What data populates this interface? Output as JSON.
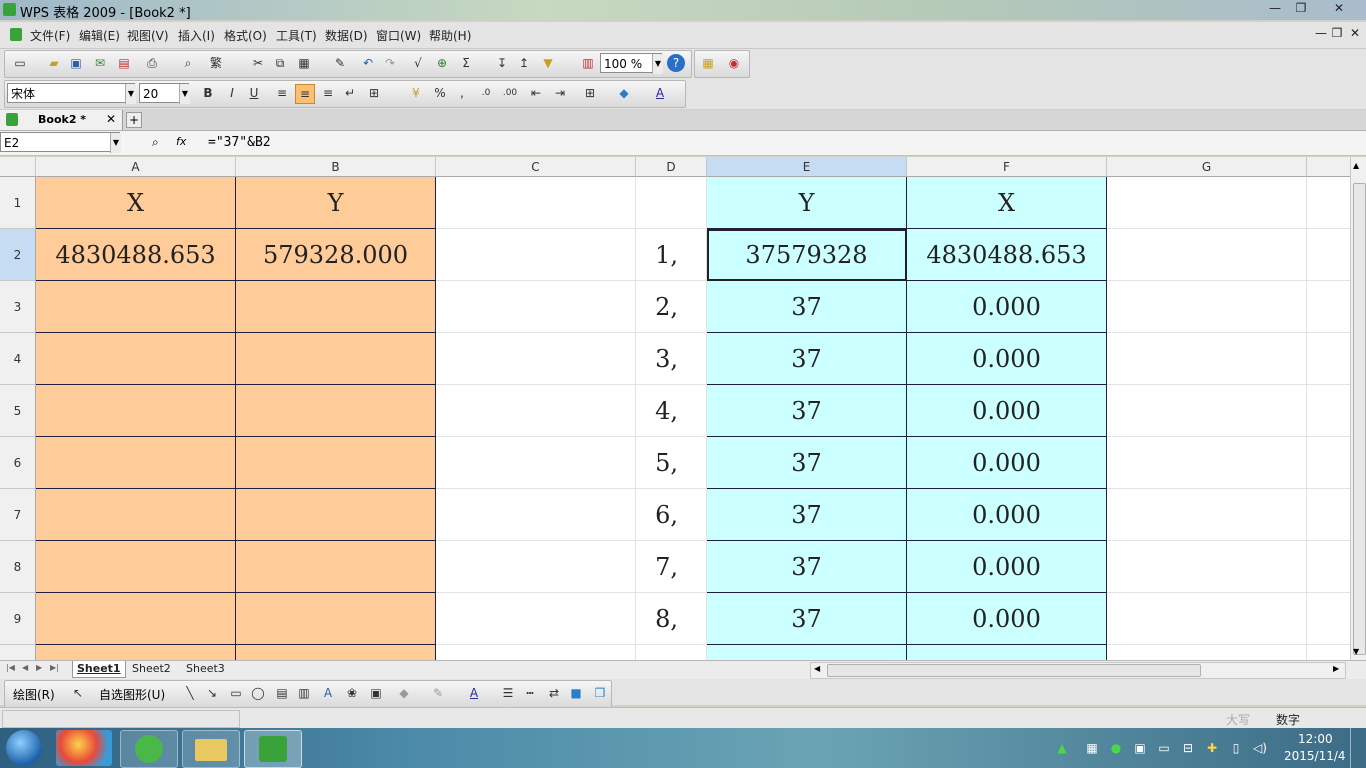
{
  "window": {
    "title": "WPS 表格 2009 - [Book2 *]"
  },
  "menu": [
    "文件(F)",
    "编辑(E)",
    "视图(V)",
    "插入(I)",
    "格式(O)",
    "工具(T)",
    "数据(D)",
    "窗口(W)",
    "帮助(H)"
  ],
  "toolbar": {
    "zoom": "100 %",
    "font_name": "宋体",
    "font_size": "20",
    "bold": "B",
    "italic": "I",
    "underline": "U",
    "percent": "%",
    "sum": "Σ"
  },
  "tabs": {
    "doc_tab": "Book2 *"
  },
  "formula_bar": {
    "name_box": "E2",
    "formula": "=\"37\"&B2",
    "fx": "fx"
  },
  "columns": [
    "A",
    "B",
    "C",
    "D",
    "E",
    "F",
    "G"
  ],
  "rows": [
    "1",
    "2",
    "3",
    "4",
    "5",
    "6",
    "7",
    "8",
    "9"
  ],
  "cells": {
    "A1": "X",
    "B1": "Y",
    "E1": "Y",
    "F1": "X",
    "A2": "4830488.653",
    "B2": "579328.000",
    "D2": "1,",
    "E2": "37579328",
    "F2": "4830488.653",
    "D3": "2,",
    "E3": "37",
    "F3": "0.000",
    "D4": "3,",
    "E4": "37",
    "F4": "0.000",
    "D5": "4,",
    "E5": "37",
    "F5": "0.000",
    "D6": "5,",
    "E6": "37",
    "F6": "0.000",
    "D7": "6,",
    "E7": "37",
    "F7": "0.000",
    "D8": "7,",
    "E8": "37",
    "F8": "0.000",
    "D9": "8,",
    "E9": "37",
    "F9": "0.000"
  },
  "sheets": [
    "Sheet1",
    "Sheet2",
    "Sheet3"
  ],
  "draw_toolbar": {
    "draw": "绘图(R)",
    "autoshapes": "自选图形(U)"
  },
  "status": {
    "caps": "大写",
    "num": "数字"
  },
  "clock": {
    "time": "12:00",
    "date": "2015/11/4"
  },
  "colors": {
    "orange_fill": "#ffcc99",
    "cyan_fill": "#ccffff"
  }
}
